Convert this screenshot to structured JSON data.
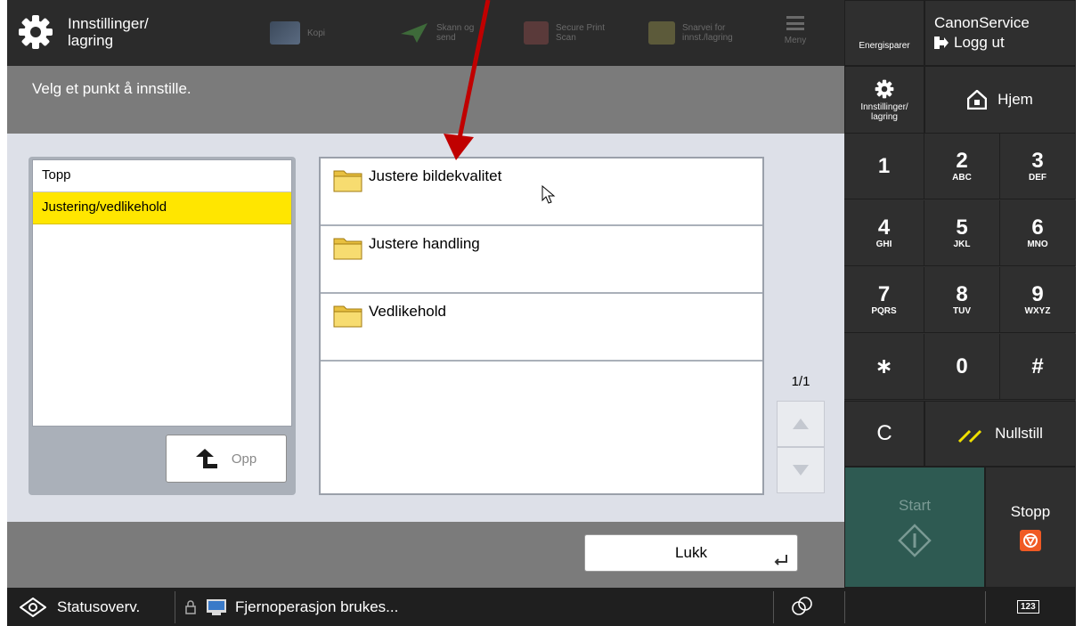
{
  "header": {
    "app_title": "Innstillinger/\nlagring",
    "tabs": [
      {
        "label": "Kopi",
        "icon": "copy-icon"
      },
      {
        "label": "Skann og\nsend",
        "icon": "scan-send-icon"
      },
      {
        "label": "Secure Print\nScan",
        "icon": "secure-print-icon"
      },
      {
        "label": "Snarvei for\ninnst./lagring",
        "icon": "shortcut-icon"
      }
    ],
    "menu_label": "Meny"
  },
  "right_panel": {
    "energy_label": "Energisparer",
    "user_name": "CanonService",
    "logout_label": "Logg ut",
    "settings_label": "Innstillinger/\nlagring",
    "home_label": "Hjem",
    "keys": [
      {
        "digit": "1",
        "letters": ""
      },
      {
        "digit": "2",
        "letters": "ABC"
      },
      {
        "digit": "3",
        "letters": "DEF"
      },
      {
        "digit": "4",
        "letters": "GHI"
      },
      {
        "digit": "5",
        "letters": "JKL"
      },
      {
        "digit": "6",
        "letters": "MNO"
      },
      {
        "digit": "7",
        "letters": "PQRS"
      },
      {
        "digit": "8",
        "letters": "TUV"
      },
      {
        "digit": "9",
        "letters": "WXYZ"
      },
      {
        "digit": "∗",
        "letters": ""
      },
      {
        "digit": "0",
        "letters": ""
      },
      {
        "digit": "#",
        "letters": ""
      }
    ],
    "clear_label": "C",
    "reset_label": "Nullstill",
    "start_label": "Start",
    "stop_label": "Stopp",
    "keypad_toggle_label": "123",
    "colors": {
      "start_bg": "#2e5a52",
      "stop_icon": "#f05a24",
      "reset_icon": "#f0e000"
    }
  },
  "message": "Velg et punkt å innstille.",
  "breadcrumb": {
    "items": [
      "Topp",
      "Justering/vedlikehold"
    ],
    "selected_index": 1,
    "up_label": "Opp"
  },
  "items": [
    {
      "label": "Justere bildekvalitet"
    },
    {
      "label": "Justere handling"
    },
    {
      "label": "Vedlikehold"
    }
  ],
  "pager": "1/1",
  "close_label": "Lukk",
  "status": {
    "status_label": "Statusoverv.",
    "remote_label": "Fjernoperasjon brukes..."
  },
  "accent": {
    "selected_row": "#ffe600",
    "annotation_arrow": "#c00000"
  }
}
